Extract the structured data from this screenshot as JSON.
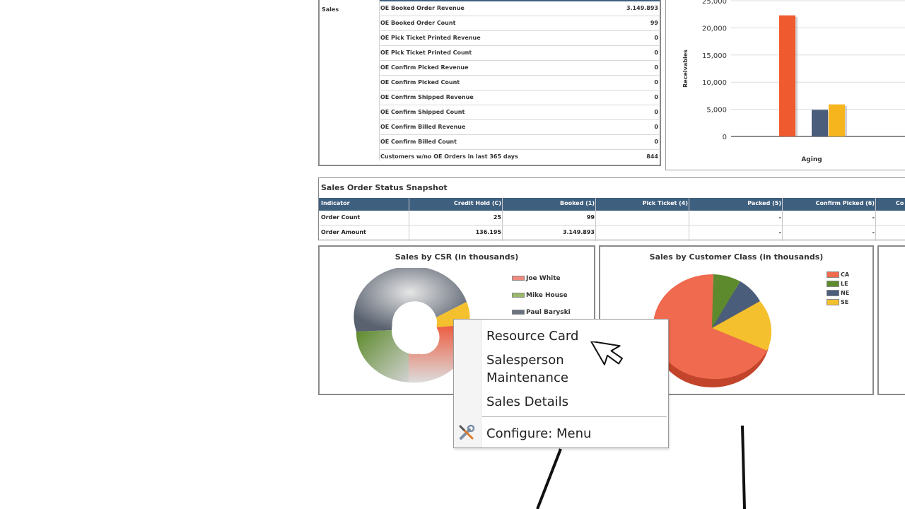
{
  "sales_table": {
    "group_label": "Sales",
    "rows": [
      {
        "label": "OE Booked Order Revenue",
        "value": "3.149.893"
      },
      {
        "label": "OE Booked Order Count",
        "value": "99"
      },
      {
        "label": "OE Pick Ticket Printed Revenue",
        "value": "0"
      },
      {
        "label": "OE Pick Ticket Printed Count",
        "value": "0"
      },
      {
        "label": "OE Confirm Picked Revenue",
        "value": "0"
      },
      {
        "label": "OE Confirm Picked Count",
        "value": "0"
      },
      {
        "label": "OE Confirm Shipped Revenue",
        "value": "0"
      },
      {
        "label": "OE Confirm Shipped Count",
        "value": "0"
      },
      {
        "label": "OE Confirm Billed Revenue",
        "value": "0"
      },
      {
        "label": "OE Confirm Billed Count",
        "value": "0"
      },
      {
        "label": "Customers w/no OE Orders in last 365 days",
        "value": "844"
      }
    ]
  },
  "chart_data": [
    {
      "type": "bar",
      "ylabel": "Receivables",
      "xlabel": "Aging",
      "yticks": [
        "0",
        "5,000",
        "10,000",
        "15,000",
        "20,000",
        "25,000"
      ],
      "ylim": [
        0,
        25000
      ],
      "grid": true,
      "series": [
        {
          "color": "#ef5a2e",
          "values": [
            22300
          ]
        },
        {
          "color": "#4a5d7a",
          "values": [
            4900
          ]
        },
        {
          "color": "#f7b51d",
          "values": [
            5900
          ]
        }
      ]
    },
    {
      "type": "pie",
      "title": "Sales by CSR (in thousands)",
      "style": "donut",
      "legend": [
        "Joe White",
        "Mike House",
        "Paul Baryski"
      ],
      "colors": [
        "#ef6a4f",
        "#6e9a3a",
        "#555f6e",
        "#f4c02e"
      ]
    },
    {
      "type": "pie",
      "title": "Sales by Customer Class (in thousands)",
      "legend": [
        "CA",
        "LE",
        "NE",
        "SE"
      ],
      "colors": [
        "#ef6a4f",
        "#5e8a2e",
        "#4a5d7a",
        "#f4c02e"
      ],
      "legend_position": "top-right"
    }
  ],
  "snapshot": {
    "title": "Sales Order Status Snapshot",
    "headers": [
      "Indicator",
      "Credit Hold (C)",
      "Booked (1)",
      "Pick Ticket (4)",
      "Packed (5)",
      "Confirm Picked (6)",
      "Co"
    ],
    "rows": [
      {
        "cells": [
          "Order Count",
          "25",
          "99",
          "",
          "-",
          "-",
          "-"
        ]
      },
      {
        "cells": [
          "Order Amount",
          "136.195",
          "3.149.893",
          "",
          "-",
          "-",
          "-"
        ]
      }
    ]
  },
  "context_menu": {
    "items": [
      "Resource Card",
      "Salesperson Maintenance",
      "Sales Details"
    ],
    "configure_label": "Configure: Menu"
  },
  "colors": {
    "header_bg": "#3f5f7f",
    "bar_orange": "#ef5a2e",
    "bar_blue": "#4a5d7a",
    "bar_yellow": "#f7b51d"
  }
}
